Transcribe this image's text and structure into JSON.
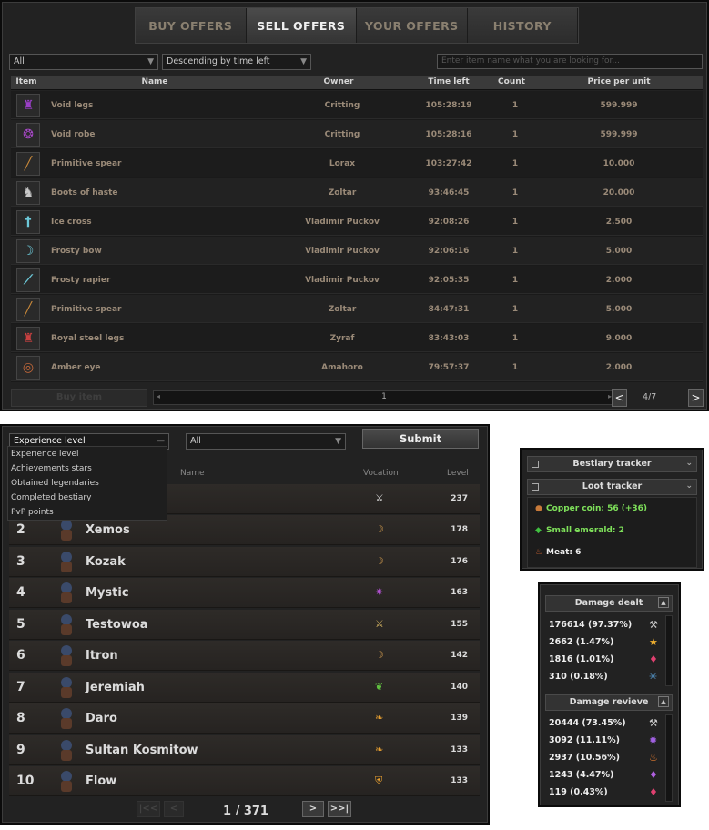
{
  "market": {
    "tabs": [
      {
        "label": "BUY OFFERS",
        "active": false
      },
      {
        "label": "SELL OFFERS",
        "active": true
      },
      {
        "label": "YOUR OFFERS",
        "active": false
      },
      {
        "label": "HISTORY",
        "active": false
      }
    ],
    "filter_value": "All",
    "sort_value": "Descending by time left",
    "search_placeholder": "Enter item name what you are looking for...",
    "columns": [
      "Item",
      "Name",
      "Owner",
      "Time left",
      "Count",
      "Price per unit"
    ],
    "rows": [
      {
        "icon": "void-legs-icon",
        "color": "#9b3fc8",
        "name": "Void legs",
        "owner": "Critting",
        "time": "105:28:19",
        "count": "1",
        "price": "599.999"
      },
      {
        "icon": "void-robe-icon",
        "color": "#a848c8",
        "name": "Void robe",
        "owner": "Critting",
        "time": "105:28:16",
        "count": "1",
        "price": "599.999"
      },
      {
        "icon": "spear-icon",
        "color": "#c8883a",
        "name": "Primitive spear",
        "owner": "Lorax",
        "time": "103:27:42",
        "count": "1",
        "price": "10.000"
      },
      {
        "icon": "boots-icon",
        "color": "#c8c8c8",
        "name": "Boots of haste",
        "owner": "Zoltar",
        "time": "93:46:45",
        "count": "1",
        "price": "20.000"
      },
      {
        "icon": "ice-cross-icon",
        "color": "#6cc8d8",
        "name": "Ice cross",
        "owner": "Vladimir Puckov",
        "time": "92:08:26",
        "count": "1",
        "price": "2.500"
      },
      {
        "icon": "bow-icon",
        "color": "#6cc8d8",
        "name": "Frosty bow",
        "owner": "Vladimir Puckov",
        "time": "92:06:16",
        "count": "1",
        "price": "5.000"
      },
      {
        "icon": "rapier-icon",
        "color": "#6cc8d8",
        "name": "Frosty rapier",
        "owner": "Vladimir Puckov",
        "time": "92:05:35",
        "count": "1",
        "price": "2.000"
      },
      {
        "icon": "spear-icon",
        "color": "#c8883a",
        "name": "Primitive spear",
        "owner": "Zoltar",
        "time": "84:47:31",
        "count": "1",
        "price": "5.000"
      },
      {
        "icon": "steel-legs-icon",
        "color": "#c84040",
        "name": "Royal steel legs",
        "owner": "Zyraf",
        "time": "83:43:03",
        "count": "1",
        "price": "9.000"
      },
      {
        "icon": "amulet-icon",
        "color": "#c86a3a",
        "name": "Amber eye",
        "owner": "Amahoro",
        "time": "79:57:37",
        "count": "1",
        "price": "2.000"
      }
    ],
    "buy_button": "Buy item",
    "scroll_value": "1",
    "page": "4/7",
    "prev": "<",
    "next": ">"
  },
  "highscore": {
    "category_value": "Experience level",
    "vocation_value": "All",
    "submit": "Submit",
    "dropdown_options": [
      "Experience level",
      "Achievements stars",
      "Obtained legendaries",
      "Completed bestiary",
      "PvP points"
    ],
    "columns": [
      "Name",
      "Vocation",
      "Level"
    ],
    "first_row_level": "237",
    "rows": [
      {
        "rank": "2",
        "name": "Xemos",
        "level": "178",
        "voc_icon": "bow-icon",
        "voc_color": "#d8a050"
      },
      {
        "rank": "3",
        "name": "Kozak",
        "level": "176",
        "voc_icon": "bow-icon",
        "voc_color": "#d8a050"
      },
      {
        "rank": "4",
        "name": "Mystic",
        "level": "163",
        "voc_icon": "magic-icon",
        "voc_color": "#b050d0"
      },
      {
        "rank": "5",
        "name": "Testowoa",
        "level": "155",
        "voc_icon": "sword-icon",
        "voc_color": "#d0b060"
      },
      {
        "rank": "6",
        "name": "Itron",
        "level": "142",
        "voc_icon": "bow-icon",
        "voc_color": "#d8a050"
      },
      {
        "rank": "7",
        "name": "Jeremiah",
        "level": "140",
        "voc_icon": "leaf-icon",
        "voc_color": "#60c040"
      },
      {
        "rank": "8",
        "name": "Daro",
        "level": "139",
        "voc_icon": "flame-icon",
        "voc_color": "#e8a030"
      },
      {
        "rank": "9",
        "name": "Sultan Kosmitow",
        "level": "133",
        "voc_icon": "flame-icon",
        "voc_color": "#e8a030"
      },
      {
        "rank": "10",
        "name": "Flow",
        "level": "133",
        "voc_icon": "shield-icon",
        "voc_color": "#e8a030"
      }
    ],
    "page_text": "1 / 371",
    "next": ">",
    "last": ">>|"
  },
  "tracker": {
    "bestiary": "Bestiary tracker",
    "loot": "Loot tracker",
    "items": [
      {
        "icon": "coin-icon",
        "color": "#c87a3a",
        "text": "Copper coin: 56 (+36)",
        "text_color": "#7ee05a"
      },
      {
        "icon": "emerald-icon",
        "color": "#40c040",
        "text": "Small emerald: 2",
        "text_color": "#7ee05a"
      },
      {
        "icon": "meat-icon",
        "color": "#c86030",
        "text": "Meat: 6",
        "text_color": "#eeeeee"
      }
    ]
  },
  "damage": {
    "dealt_title": "Damage dealt",
    "dealt": [
      {
        "text": "176614 (97.37%)",
        "icon": "physical-icon",
        "color": "#cccccc"
      },
      {
        "text": "2662 (1.47%)",
        "icon": "holy-icon",
        "color": "#f0b030"
      },
      {
        "text": "1816 (1.01%)",
        "icon": "life-drain-icon",
        "color": "#e04070"
      },
      {
        "text": "310 (0.18%)",
        "icon": "ice-icon",
        "color": "#60b0f0"
      }
    ],
    "received_title": "Damage revieve",
    "received": [
      {
        "text": "20444 (73.45%)",
        "icon": "physical-icon",
        "color": "#cccccc"
      },
      {
        "text": "3092 (11.11%)",
        "icon": "death-icon",
        "color": "#a060e0"
      },
      {
        "text": "2937 (10.56%)",
        "icon": "fire-icon",
        "color": "#f08030"
      },
      {
        "text": "1243 (4.47%)",
        "icon": "energy-icon",
        "color": "#b060e0"
      },
      {
        "text": "119 (0.43%)",
        "icon": "life-drain-icon",
        "color": "#e04070"
      }
    ]
  }
}
